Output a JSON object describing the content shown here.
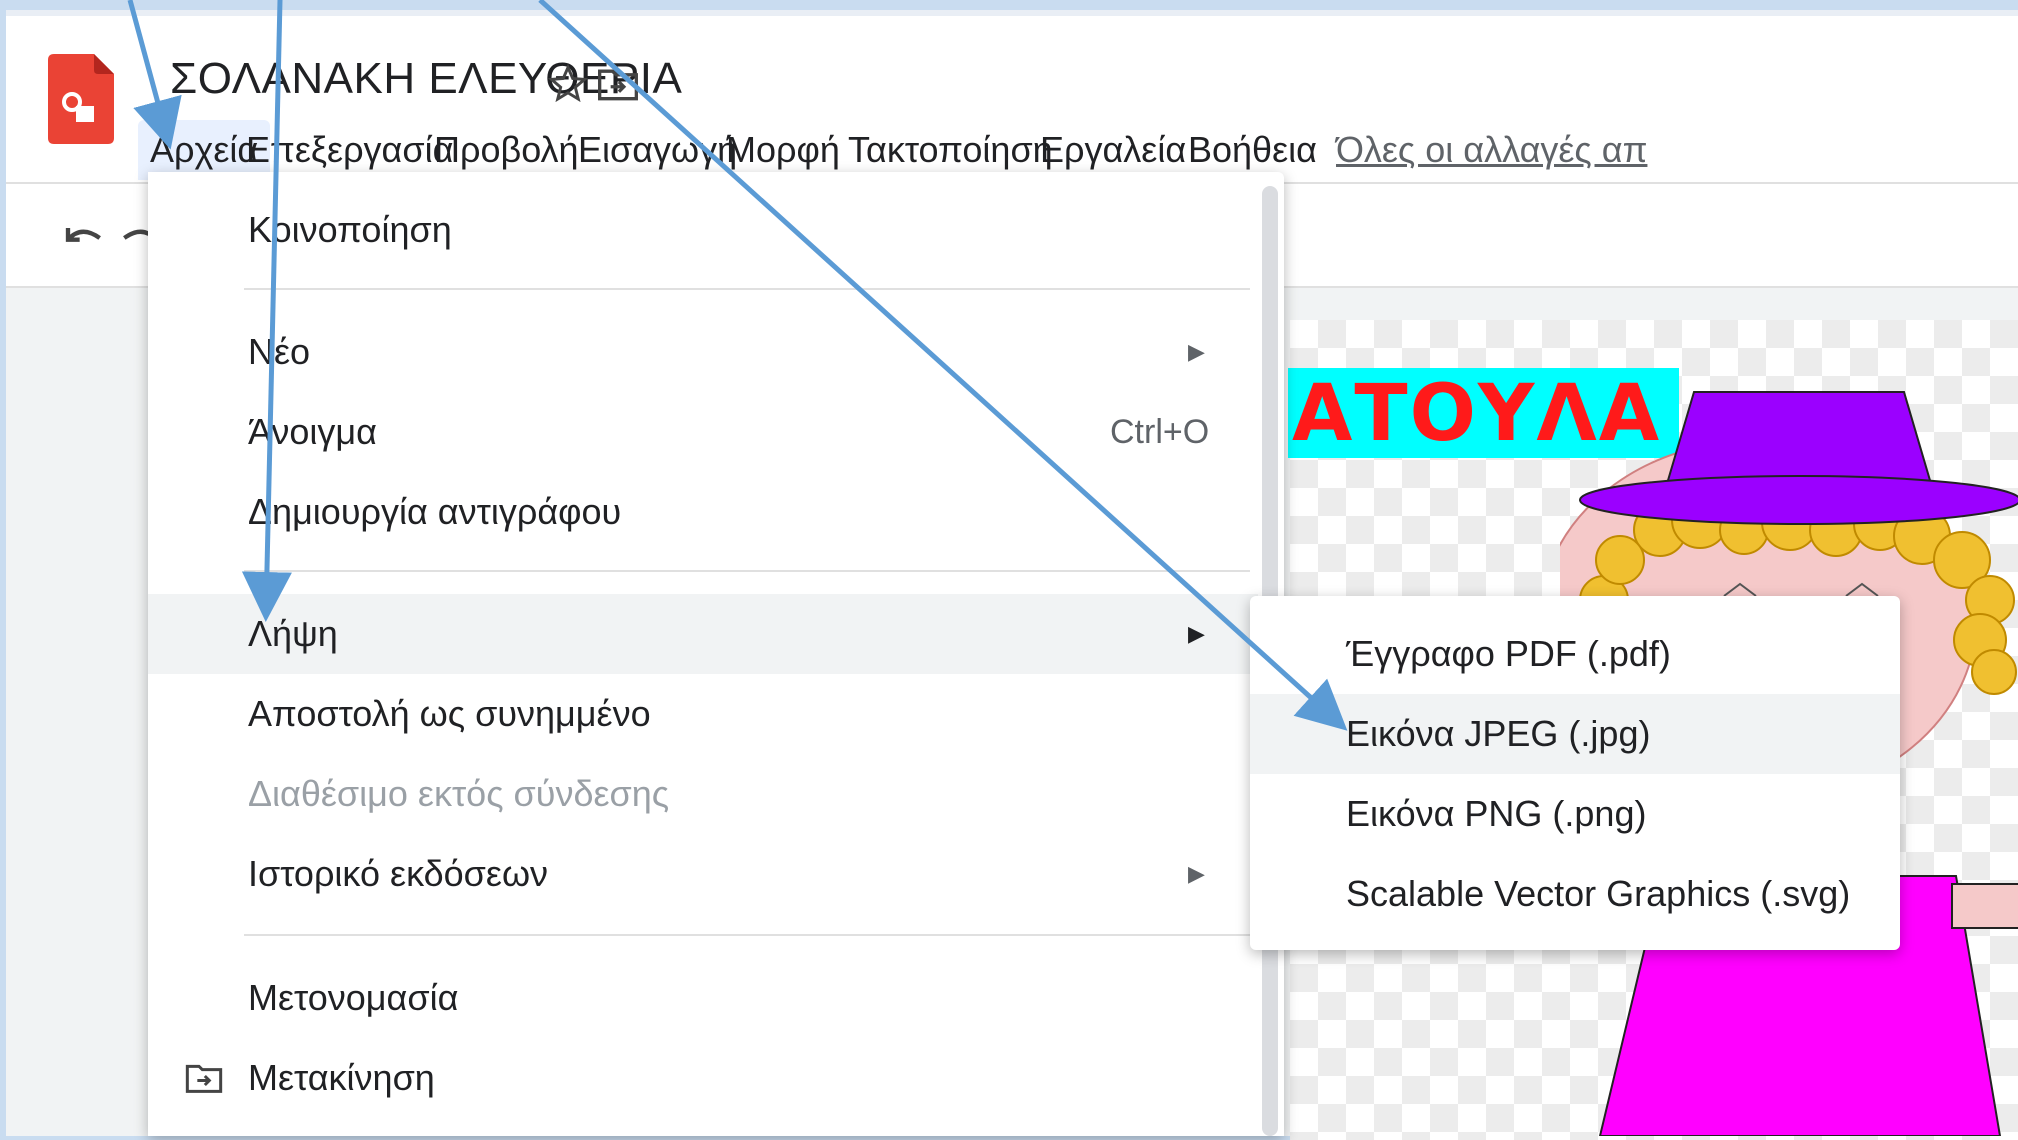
{
  "app": {
    "title": "ΣΟΛΑΝΑΚΗ ΕΛΕΥΘΕΡΙΑ",
    "star_icon": "star-icon",
    "move_icon": "move-to-folder-icon",
    "brand_color": "#ea4335"
  },
  "menubar": {
    "items": [
      "Αρχεία",
      "Επεξεργασία",
      "Προβολή",
      "Εισαγωγή",
      "Μορφή",
      "Τακτοποίηση",
      "Εργαλεία",
      "Βοήθεια"
    ],
    "saved_status": "Όλες οι αλλαγές απ"
  },
  "toolbar": {
    "undo_icon": "undo-icon",
    "redo_icon": "redo-icon"
  },
  "file_menu": {
    "share": "Κοινοποίηση",
    "new": "Νέο",
    "open": "Άνοιγμα",
    "open_shortcut": "Ctrl+O",
    "make_copy": "Δημιουργία αντιγράφου",
    "download": "Λήψη",
    "email_attachment": "Αποστολή ως συνημμένο",
    "offline": "Διαθέσιμο εκτός σύνδεσης",
    "version_history": "Ιστορικό εκδόσεων",
    "rename": "Μετονομασία",
    "move": "Μετακίνηση"
  },
  "download_submenu": {
    "pdf": "Έγγραφο PDF (.pdf)",
    "jpg": "Εικόνα JPEG (.jpg)",
    "png": "Εικόνα PNG (.png)",
    "svg": "Scalable Vector Graphics (.svg)"
  },
  "canvas": {
    "title_text": "ΑΤΟΥΛΑ",
    "title_bg": "#00ffff",
    "title_color": "#ff1a1a"
  },
  "annotation": {
    "arrow_color": "#5b9bd5"
  }
}
